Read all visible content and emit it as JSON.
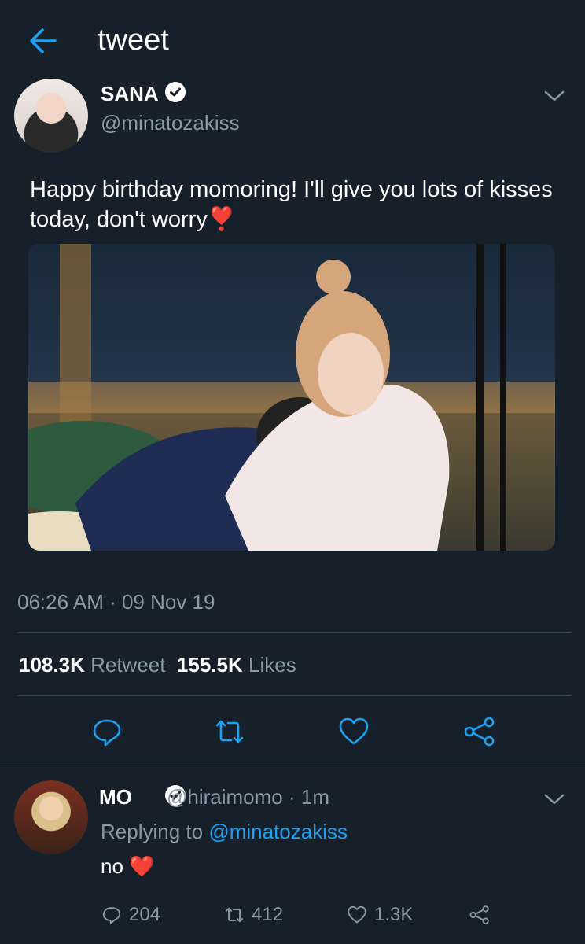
{
  "header": {
    "title": "tweet"
  },
  "tweet": {
    "author_name": "SANA",
    "author_handle": "@minatozakiss",
    "text": "Happy birthday momoring! I'll give you lots of kisses today, don't worry",
    "emoji": "❣️",
    "timestamp": "06:26 AM · 09 Nov 19",
    "retweet_count": "108.3K",
    "retweet_label": "Retweet",
    "like_count": "155.5K",
    "like_label": "Likes"
  },
  "reply": {
    "author_name": "MO",
    "author_handle": "@hiraimomo",
    "time": "· 1m",
    "replying_prefix": "Replying to",
    "replying_handle": "@minatozakiss",
    "text": "no",
    "emoji": "❤️",
    "reply_count": "204",
    "retweet_count": "412",
    "like_count": "1.3K"
  },
  "icons": {
    "back": "arrow-left-icon",
    "verified": "verified-badge-icon",
    "chevron": "chevron-down-icon",
    "reply": "reply-icon",
    "retweet": "retweet-icon",
    "like": "heart-icon",
    "share": "share-icon"
  },
  "colors": {
    "background": "#15202b",
    "accent": "#1da1f2",
    "muted": "#8899a6",
    "heart": "#e0245e"
  }
}
